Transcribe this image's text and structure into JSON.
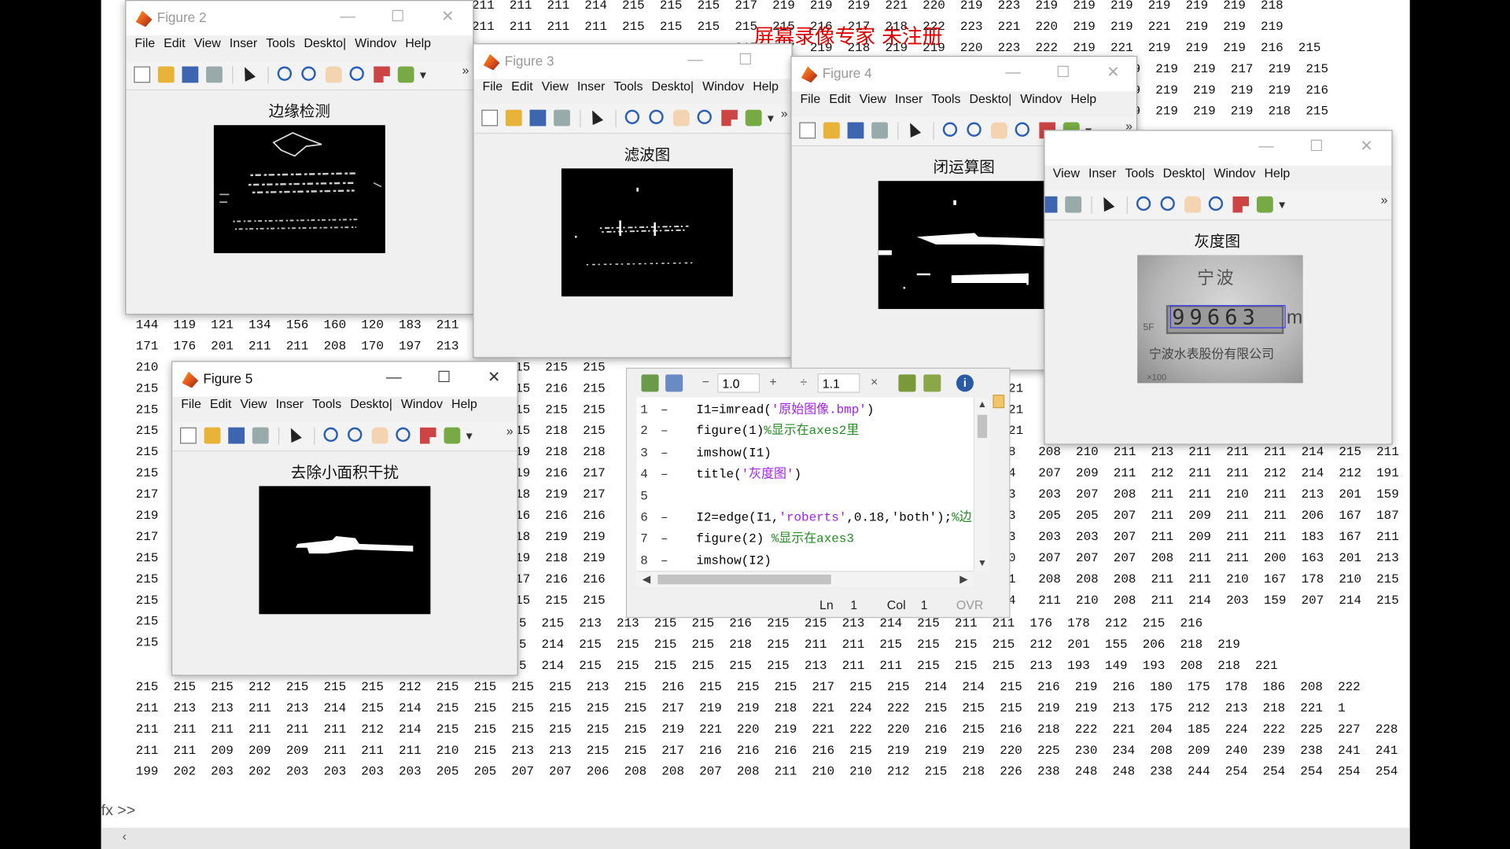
{
  "watermark": "屏幕录像专家 未注册",
  "matrix": {
    "top": "211  211  211  214  215  215  215  217  219  219  219  221  220  219  223  219  219  219  219  219  219  218\n211  211  211  211  215  215  215  215  215  216  217  218  222  223  221  220  219  219  221  219  219  219\n                                   215  217  219  218  219  219  220  223  222  219  221  219  219  219  216  215\n                                                                                 219  219  219  219  217  219  215\n                                                                                 219  219  219  219  219  219  216\n                                                                                 219  219  219  219  219  218  215",
    "left_lines": [
      "144  119  121  134  156  160  120  183  211",
      "171  176  201  211  211  208  170  197  213",
      "210",
      "215",
      "215",
      "215",
      "215",
      "215",
      "217",
      "219",
      "217",
      "215",
      "215",
      "215",
      "215",
      "215"
    ],
    "mid_lines": [
      "15  215  215",
      "15  216  215",
      "15  215  215",
      "15  218  215",
      "19  218  218",
      "19  216  217",
      "18  219  217",
      "16  216  216",
      "18  219  219",
      "19  218  219",
      "17  216  216",
      "15  215  215"
    ],
    "right_lines": [
      "21",
      "21",
      "21",
      "21",
      "8   208  210  211  213  211  211  211  214  215  211",
      "4   207  209  211  212  211  211  212  214  212  191",
      "3   203  207  208  211  211  210  211  213  201  159",
      "3   205  205  207  211  209  211  211  206  167  187",
      "3   203  203  207  211  209  211  211  183  167  211",
      "0   207  207  207  208  211  211  200  163  201  213",
      "1   208  208  208  211  211  210  167  178  210  215",
      "4   211  210  208  211  214  203  159  207  214  215"
    ],
    "bottom": "                                   15  215  215  215  215  213  213  215  215  216  215  215  213  214  215  211  211  176  178  212  215  216\n                                   15  215  215  215  214  215  215  215  215  218  215  211  211  215  215  215  215  212  201  155  206  218  219\n                                   15  215  214  215  214  215  215  215  215  215  215  213  211  211  215  215  215  213  193  149  193  208  218  221\n215  215  215  212  215  215  215  212  215  215  215  215  213  215  216  215  215  215  217  215  215  214  214  215  216  219  216  180  175  178  186  208  222\n211  213  213  211  213  214  215  214  215  215  215  215  215  215  217  219  219  218  221  224  222  215  215  215  219  219  213  175  212  213  218  221  1\n211  211  211  211  211  211  212  214  215  215  215  215  215  215  219  221  220  219  221  222  220  216  215  216  218  222  221  204  185  224  222  225  227  228\n211  211  209  209  209  211  211  211  210  215  213  213  215  215  217  216  216  216  216  215  219  219  219  220  225  230  234  208  209  240  239  238  241  241\n199  202  203  202  203  203  203  203  205  205  207  207  206  208  208  207  208  211  210  210  212  215  218  226  238  248  248  238  244  254  254  254  254  254"
  },
  "menu_items": [
    "File",
    "Edit",
    "View",
    "Inser",
    "Tools",
    "Deskto|",
    "Windov",
    "Help"
  ],
  "figures": {
    "fig2": {
      "title": "Figure 2",
      "plot_title": "边缘检测"
    },
    "fig3": {
      "title": "Figure 3",
      "plot_title": "滤波图"
    },
    "fig4": {
      "title": "Figure 4",
      "plot_title": "闭运算图"
    },
    "fig1": {
      "title": "",
      "plot_title": "灰度图",
      "meter_digits": "99663",
      "meter_brand": "宁波",
      "meter_company": "宁波水表股份有限公司",
      "meter_unit": "m",
      "meter_side": "5F",
      "meter_small": "×100"
    },
    "fig5": {
      "title": "Figure 5",
      "plot_title": "去除小面积干扰"
    }
  },
  "editor": {
    "zoom_a": "1.0",
    "zoom_b": "1.1",
    "lines": [
      {
        "n": "1",
        "dash": "–",
        "pre": "I1=imread(",
        "str": "'原始图像.bmp'",
        "post": ")",
        "cmt": ""
      },
      {
        "n": "2",
        "dash": "–",
        "pre": "figure(1)",
        "str": "",
        "post": "",
        "cmt": "%显示在axes2里"
      },
      {
        "n": "3",
        "dash": "–",
        "pre": "imshow(I1)",
        "str": "",
        "post": "",
        "cmt": ""
      },
      {
        "n": "4",
        "dash": "–",
        "pre": "title(",
        "str": "'灰度图'",
        "post": ")",
        "cmt": ""
      },
      {
        "n": "5",
        "dash": "",
        "pre": "",
        "str": "",
        "post": "",
        "cmt": ""
      },
      {
        "n": "6",
        "dash": "–",
        "pre": "I2=edge(I1,",
        "str": "'roberts'",
        "post": ",0.18,'both');",
        "cmt": "%边"
      },
      {
        "n": "7",
        "dash": "–",
        "pre": "figure(2) ",
        "str": "",
        "post": "",
        "cmt": "%显示在axes3"
      },
      {
        "n": "8",
        "dash": "–",
        "pre": "imshow(I2)",
        "str": "",
        "post": "",
        "cmt": ""
      }
    ],
    "status_ln_label": "Ln",
    "status_ln": "1",
    "status_col_label": "Col",
    "status_col": "1",
    "status_ovr": "OVR"
  },
  "command_prompt": "fx >>"
}
